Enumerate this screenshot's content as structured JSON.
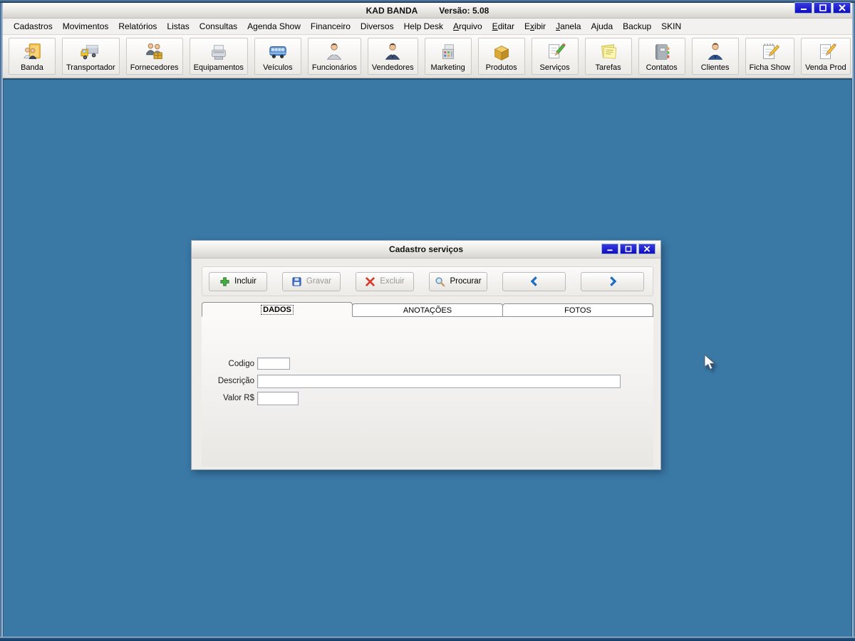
{
  "window": {
    "app_title": "KAD BANDA",
    "version_label": "Versão: 5.08"
  },
  "menu": {
    "items": [
      {
        "pre": "Cadastros",
        "accel": "",
        "post": ""
      },
      {
        "pre": "Movimentos",
        "accel": "",
        "post": ""
      },
      {
        "pre": "Relatórios",
        "accel": "",
        "post": ""
      },
      {
        "pre": "Listas",
        "accel": "",
        "post": ""
      },
      {
        "pre": "Consultas",
        "accel": "",
        "post": ""
      },
      {
        "pre": "Agenda Show",
        "accel": "",
        "post": ""
      },
      {
        "pre": "Financeiro",
        "accel": "",
        "post": ""
      },
      {
        "pre": "Diversos",
        "accel": "",
        "post": ""
      },
      {
        "pre": "Help Desk",
        "accel": "",
        "post": ""
      },
      {
        "pre": "",
        "accel": "A",
        "post": "rquivo"
      },
      {
        "pre": "",
        "accel": "E",
        "post": "ditar"
      },
      {
        "pre": "E",
        "accel": "x",
        "post": "ibir"
      },
      {
        "pre": "",
        "accel": "J",
        "post": "anela"
      },
      {
        "pre": "Ajuda",
        "accel": "",
        "post": ""
      },
      {
        "pre": "Backup",
        "accel": "",
        "post": ""
      },
      {
        "pre": "SKIN",
        "accel": "",
        "post": ""
      }
    ]
  },
  "toolbar": {
    "items": [
      {
        "label": "Banda",
        "icon": "band-folder-icon"
      },
      {
        "label": "Transportador",
        "icon": "truck-icon"
      },
      {
        "label": "Fornecedores",
        "icon": "suppliers-icon"
      },
      {
        "label": "Equipamentos",
        "icon": "equipment-printer-icon"
      },
      {
        "label": "Veículos",
        "icon": "bus-icon"
      },
      {
        "label": "Funcionários",
        "icon": "employee-icon"
      },
      {
        "label": "Vendedores",
        "icon": "salesman-icon"
      },
      {
        "label": "Marketing",
        "icon": "marketing-icon"
      },
      {
        "label": "Produtos",
        "icon": "product-box-icon"
      },
      {
        "label": "Serviços",
        "icon": "services-doc-icon"
      },
      {
        "label": "Tarefas",
        "icon": "tasks-notes-icon"
      },
      {
        "label": "Contatos",
        "icon": "contacts-book-icon"
      },
      {
        "label": "Clientes",
        "icon": "client-person-icon"
      },
      {
        "label": "Ficha Show",
        "icon": "show-sheet-icon"
      },
      {
        "label": "Venda Prod",
        "icon": "sale-doc-icon"
      }
    ]
  },
  "dialog": {
    "title": "Cadastro serviços",
    "actions": {
      "incluir": "Incluir",
      "gravar": "Gravar",
      "excluir": "Excluir",
      "procurar": "Procurar"
    },
    "tabs": [
      {
        "label": "DADOS",
        "active": true
      },
      {
        "label": "ANOTAÇÕES",
        "active": false
      },
      {
        "label": "FOTOS",
        "active": false
      }
    ],
    "fields": [
      {
        "label": "Codigo",
        "value": ""
      },
      {
        "label": "Descrição",
        "value": ""
      },
      {
        "label": "Valor R$",
        "value": ""
      }
    ]
  },
  "colors": {
    "desktop_blue": "#3a79a6",
    "control_button_blue": "#1414c8",
    "incluir_green": "#44b044",
    "gravar_blue": "#3f6fc9",
    "excluir_red": "#d63a2a",
    "arrow_blue": "#1a6cc4"
  }
}
